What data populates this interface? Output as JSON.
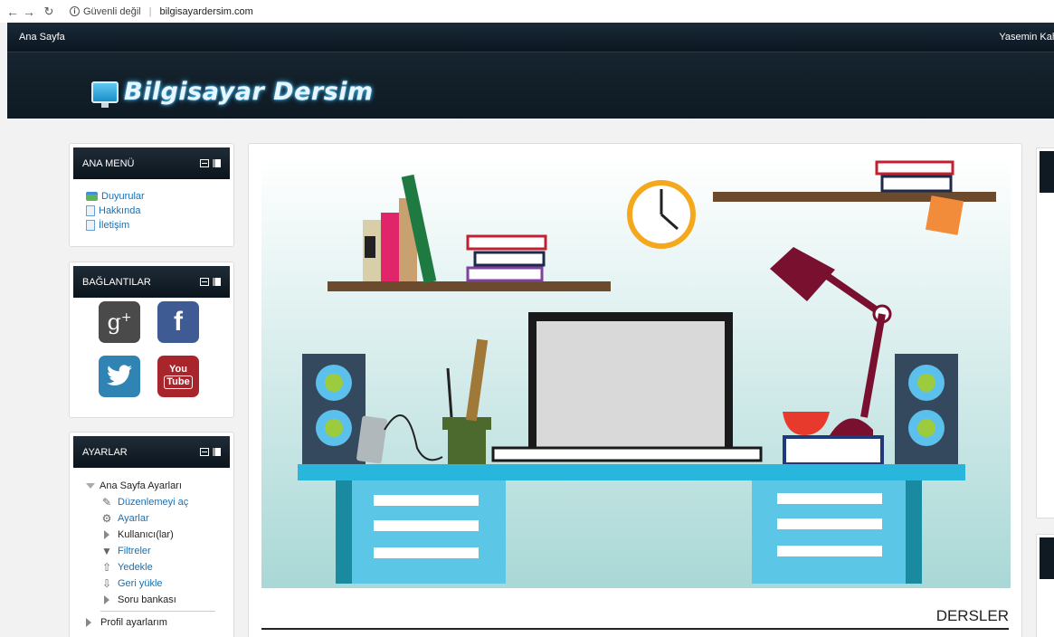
{
  "browser": {
    "security_label": "Güvenli değil",
    "url": "bilgisayardersim.com"
  },
  "topbar": {
    "home_label": "Ana Sayfa",
    "user_label": "Yasemin Kah"
  },
  "header": {
    "site_title": "Bilgisayar Dersim"
  },
  "main_menu": {
    "title": "ANA MENÜ",
    "items": [
      {
        "label": "Duyurular",
        "icon": "speech-bubble-icon"
      },
      {
        "label": "Hakkında",
        "icon": "page-icon"
      },
      {
        "label": "İletişim",
        "icon": "page-icon"
      }
    ]
  },
  "links_block": {
    "title": "BAĞLANTILAR",
    "items": [
      {
        "icon": "google-plus-icon",
        "glyph": "g+",
        "color": "#4a4a4a"
      },
      {
        "icon": "facebook-icon",
        "glyph": "f",
        "color": "#3f5b93"
      },
      {
        "icon": "twitter-icon",
        "color": "#2f84b4"
      },
      {
        "icon": "youtube-icon",
        "glyph_top": "You",
        "glyph_bottom": "Tube",
        "color": "#a8262b"
      }
    ]
  },
  "settings_block": {
    "title": "AYARLAR",
    "home_settings": "Ana Sayfa Ayarları",
    "items": [
      {
        "label": "Düzenlemeyi aç",
        "icon": "pencil-icon"
      },
      {
        "label": "Ayarlar",
        "icon": "gear-icon"
      },
      {
        "label": "Kullanıcı(lar)",
        "icon": "chevron-right-icon"
      },
      {
        "label": "Filtreler",
        "icon": "filter-icon"
      },
      {
        "label": "Yedekle",
        "icon": "upload-icon"
      },
      {
        "label": "Geri yükle",
        "icon": "download-icon"
      },
      {
        "label": "Soru bankası",
        "icon": "chevron-right-icon"
      }
    ],
    "profile_settings": "Profil ayarlarım"
  },
  "main": {
    "section_title": "DERSLER"
  },
  "colors": {
    "nav_dark": "#0b1620",
    "link_blue": "#1a6fb0",
    "desk_cyan": "#29b6dc"
  }
}
